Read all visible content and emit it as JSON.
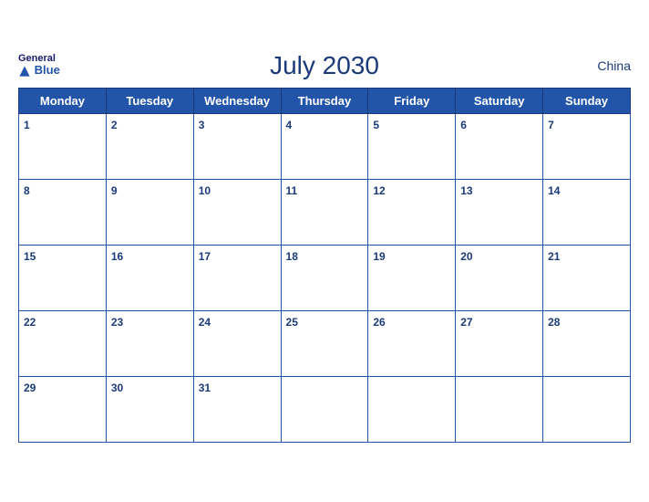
{
  "header": {
    "title": "July 2030",
    "country": "China",
    "logo_line1": "General",
    "logo_line2": "Blue"
  },
  "weekdays": [
    "Monday",
    "Tuesday",
    "Wednesday",
    "Thursday",
    "Friday",
    "Saturday",
    "Sunday"
  ],
  "weeks": [
    [
      1,
      2,
      3,
      4,
      5,
      6,
      7
    ],
    [
      8,
      9,
      10,
      11,
      12,
      13,
      14
    ],
    [
      15,
      16,
      17,
      18,
      19,
      20,
      21
    ],
    [
      22,
      23,
      24,
      25,
      26,
      27,
      28
    ],
    [
      29,
      30,
      31,
      null,
      null,
      null,
      null
    ]
  ]
}
